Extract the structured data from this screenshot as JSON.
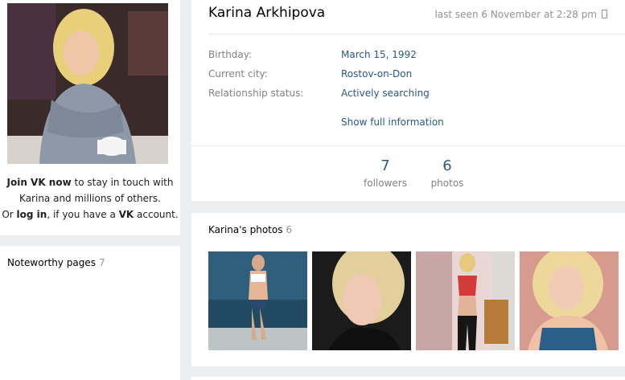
{
  "profile": {
    "name": "Karina Arkhipova",
    "last_seen": "last seen 6 November at 2:28 pm",
    "info": [
      {
        "label": "Birthday:",
        "value": "March 15, 1992"
      },
      {
        "label": "Current city:",
        "value": "Rostov-on-Don"
      },
      {
        "label": "Relationship status:",
        "value": "Actively searching"
      }
    ],
    "show_full": "Show full information",
    "stats": [
      {
        "count": "7",
        "label": "followers"
      },
      {
        "count": "6",
        "label": "photos"
      }
    ]
  },
  "join": {
    "join_link": "Join VK now",
    "line1_rest": " to stay in touch with",
    "line2": "Karina and millions of others.",
    "or": "Or ",
    "login_link": "log in",
    "mid": ", if you have a ",
    "vk": "VK",
    "end": " account."
  },
  "noteworthy": {
    "title": "Noteworthy pages",
    "count": "7"
  },
  "photos": {
    "title": "Karina's photos",
    "count": "6"
  }
}
